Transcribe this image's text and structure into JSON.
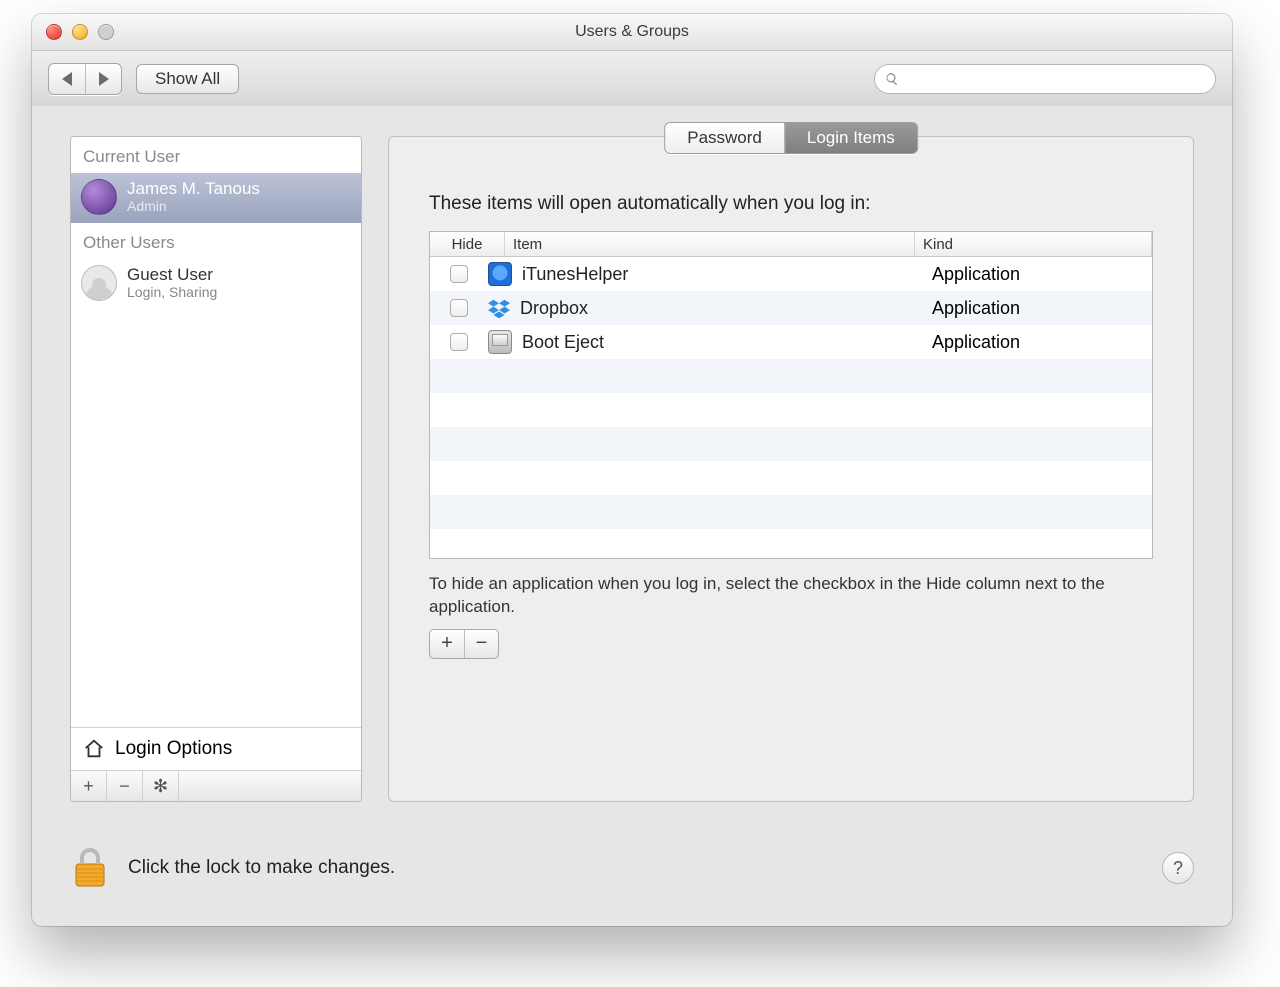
{
  "window": {
    "title": "Users & Groups"
  },
  "toolbar": {
    "show_all": "Show All",
    "search_placeholder": ""
  },
  "sidebar": {
    "current_label": "Current User",
    "other_label": "Other Users",
    "current_user": {
      "name": "James M. Tanous",
      "role": "Admin"
    },
    "other_users": [
      {
        "name": "Guest User",
        "role": "Login, Sharing"
      }
    ],
    "login_options": "Login Options"
  },
  "tabs": {
    "password": "Password",
    "login_items": "Login Items",
    "active": "login_items"
  },
  "content": {
    "intro": "These items will open automatically when you log in:",
    "columns": {
      "hide": "Hide",
      "item": "Item",
      "kind": "Kind"
    },
    "rows": [
      {
        "hide": false,
        "icon": "itunes-icon",
        "name": "iTunesHelper",
        "kind": "Application"
      },
      {
        "hide": false,
        "icon": "dropbox-icon",
        "name": "Dropbox",
        "kind": "Application"
      },
      {
        "hide": false,
        "icon": "script-icon",
        "name": "Boot Eject",
        "kind": "Application"
      }
    ],
    "hint": "To hide an application when you log in, select the checkbox in the Hide column next to the application."
  },
  "footer": {
    "lock_text": "Click the lock to make changes."
  },
  "glyphs": {
    "plus": "+",
    "minus": "−",
    "gear": "✻",
    "help": "?"
  }
}
